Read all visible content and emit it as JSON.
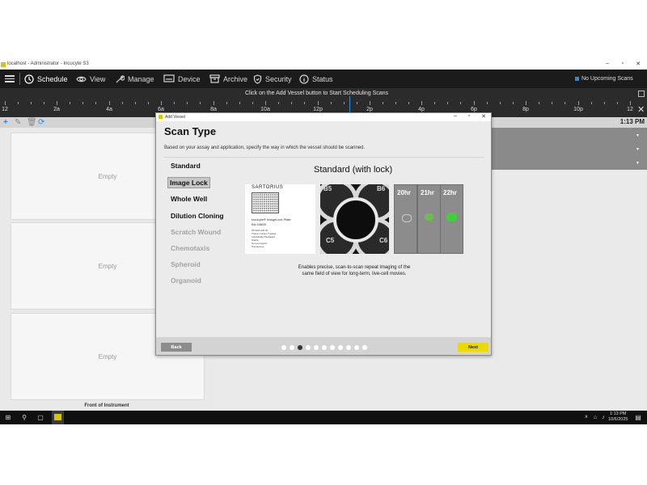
{
  "window": {
    "title": "localhost - Administrator - Incucyte S3",
    "minimize": "–",
    "maximize": "▫",
    "close": "✕"
  },
  "nav": {
    "items": [
      {
        "label": "Schedule",
        "icon": "clock-icon"
      },
      {
        "label": "View",
        "icon": "eye-icon"
      },
      {
        "label": "Manage",
        "icon": "wrench-icon"
      },
      {
        "label": "Device",
        "icon": "device-icon"
      },
      {
        "label": "Archive",
        "icon": "archive-icon"
      },
      {
        "label": "Security",
        "icon": "shield-icon"
      },
      {
        "label": "Status",
        "icon": "info-icon"
      }
    ],
    "upcoming": "No Upcoming Scans"
  },
  "timeline": {
    "instruction": "Click on the Add Vessel button to Start Scheduling Scans",
    "ticks": [
      "12",
      "2a",
      "4a",
      "6a",
      "8a",
      "10a",
      "12p",
      "2p",
      "4p",
      "6p",
      "8p",
      "10p",
      "12"
    ],
    "clock": "1:13 PM"
  },
  "slots": {
    "empty1": "Empty",
    "empty2": "Empty",
    "empty3": "Empty",
    "front": "Front of Instrument"
  },
  "dialog": {
    "title": "Add Vessel",
    "heading": "Scan Type",
    "subtitle": "Based on your assay and application, specify the way in which the vessel should be scanned.",
    "options": [
      {
        "label": "Standard",
        "state": "enabled"
      },
      {
        "label": "Image Lock",
        "state": "selected"
      },
      {
        "label": "Whole Well",
        "state": "enabled"
      },
      {
        "label": "Dilution Cloning",
        "state": "enabled"
      },
      {
        "label": "Scratch Wound",
        "state": "disabled"
      },
      {
        "label": "Chemotaxis",
        "state": "disabled"
      },
      {
        "label": "Spheroid",
        "state": "disabled"
      },
      {
        "label": "Organoid",
        "state": "disabled"
      }
    ],
    "content_title": "Standard (with lock)",
    "image1": {
      "brand": "SARTORIUS",
      "product": "Incucyte® ImageLock Plate",
      "code": "BA-04855",
      "bullets": [
        "96-Well with lid",
        "Tissue Culture Treated",
        "Individually Packaged",
        "Sterile",
        "Non-pyrogenic",
        "Polystyrene"
      ]
    },
    "image2": {
      "labels": [
        "B5",
        "B6",
        "C5",
        "C6"
      ]
    },
    "image3": {
      "labels": [
        "20hr",
        "21hr",
        "22hr"
      ]
    },
    "description_line1": "Enables precise, scan-to-scan repeat imaging of the",
    "description_line2": "same field of view for long-term, live-cell movies.",
    "back": "Back",
    "next": "Next",
    "steps_total": 11,
    "step_current": 3
  },
  "taskbar": {
    "time": "1:13 PM",
    "date": "10/6/2025"
  },
  "colors": {
    "accent": "#2d8be0",
    "next_button": "#ecd900",
    "nav_bg": "#1b1b1b"
  }
}
